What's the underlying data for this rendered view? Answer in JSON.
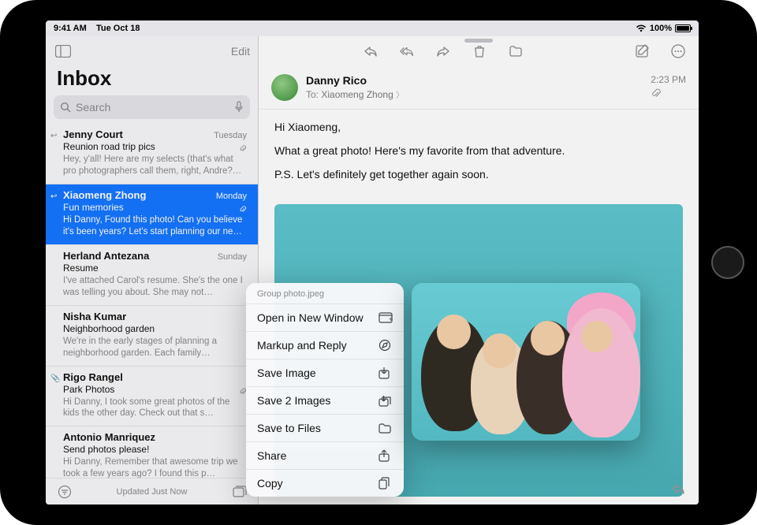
{
  "status": {
    "time": "9:41 AM",
    "date": "Tue Oct 18",
    "battery": "100%"
  },
  "sidebar": {
    "edit_label": "Edit",
    "title": "Inbox",
    "search_placeholder": "Search",
    "footer_status": "Updated Just Now",
    "threads": [
      {
        "sender": "Jenny Court",
        "date": "Tuesday",
        "subject": "Reunion road trip pics",
        "preview": "Hey, y'all! Here are my selects (that's what pro photographers call them, right, Andre?…",
        "replied": true,
        "attachment": true,
        "selected": false
      },
      {
        "sender": "Xiaomeng Zhong",
        "date": "Monday",
        "subject": "Fun memories",
        "preview": "Hi Danny, Found this photo! Can you believe it's been years? Let's start planning our ne…",
        "replied": true,
        "attachment": true,
        "selected": true
      },
      {
        "sender": "Herland Antezana",
        "date": "Sunday",
        "subject": "Resume",
        "preview": "I've attached Carol's resume. She's the one I was telling you about. She may not…",
        "replied": false,
        "attachment": false,
        "selected": false
      },
      {
        "sender": "Nisha Kumar",
        "date": "",
        "subject": "Neighborhood garden",
        "preview": "We're in the early stages of planning a neighborhood garden. Each family…",
        "replied": false,
        "attachment": false,
        "selected": false
      },
      {
        "sender": "Rigo Rangel",
        "date": "",
        "subject": "Park Photos",
        "preview": "Hi Danny, I took some great photos of the kids the other day. Check out that s…",
        "replied": false,
        "attachment": true,
        "selected": false
      },
      {
        "sender": "Antonio Manriquez",
        "date": "",
        "subject": "Send photos please!",
        "preview": "Hi Danny, Remember that awesome trip we took a few years ago? I found this p…",
        "replied": false,
        "attachment": false,
        "selected": false
      }
    ]
  },
  "message": {
    "from": "Danny Rico",
    "to_label": "To:",
    "to_name": "Xiaomeng Zhong",
    "time": "2:23 PM",
    "has_attachment": true,
    "body": {
      "line1": "Hi Xiaomeng,",
      "line2": "What a great photo! Here's my favorite from that adventure.",
      "line3": "P.S. Let's definitely get together again soon."
    }
  },
  "context_menu": {
    "filename": "Group photo.jpeg",
    "items": [
      {
        "label": "Open in New Window",
        "icon": "window-add-icon"
      },
      {
        "label": "Markup and Reply",
        "icon": "markup-icon"
      },
      {
        "label": "Save Image",
        "icon": "save-down-icon"
      },
      {
        "label": "Save 2 Images",
        "icon": "save-down-multi-icon"
      },
      {
        "label": "Save to Files",
        "icon": "folder-icon"
      },
      {
        "label": "Share",
        "icon": "share-icon"
      },
      {
        "label": "Copy",
        "icon": "copy-icon"
      }
    ]
  }
}
